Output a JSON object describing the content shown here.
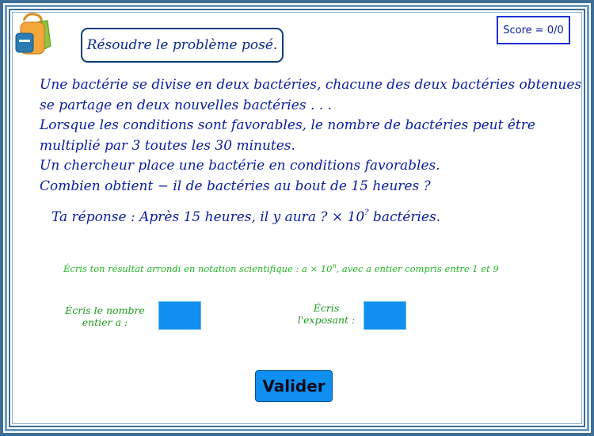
{
  "score_text": "Score = 0/0",
  "title": "Résoudre le problème posé.",
  "problem_lines": [
    "Une bactérie se divise en deux bactéries, chacune des deux bactéries obtenues",
    "se partage en deux nouvelles bactéries . . .",
    "Lorsque les conditions sont favorables, le nombre de bactéries peut être",
    "multiplié par 3 toutes les 30 minutes.",
    "Un chercheur place une bactérie en conditions favorables.",
    "Combien obtient − il de bactéries au bout de 15 heures ?"
  ],
  "answer": {
    "prefix": "Ta réponse :  Après 15 heures, il y aura ? × 10",
    "exponent": "?",
    "suffix": " bactéries."
  },
  "hint": {
    "prefix": "Écris ton résultat arrondi en notation scientifique : a × 10",
    "exponent": "n",
    "suffix": ", avec a entier compris entre 1 et 9"
  },
  "label_a": {
    "line1": "Écris le nombre",
    "line2": "entier a :"
  },
  "label_n": {
    "line1": "Écris",
    "line2": "l'exposant :"
  },
  "input_a_value": "",
  "input_n_value": "",
  "validate_label": "Valider",
  "icon": "backpack-icon",
  "colors": {
    "frame": "#3c6e96",
    "text_blue": "#0a1e9e",
    "text_green": "#22b524",
    "input_blue": "#0f8ff0",
    "score_border": "#1d2fd6"
  }
}
